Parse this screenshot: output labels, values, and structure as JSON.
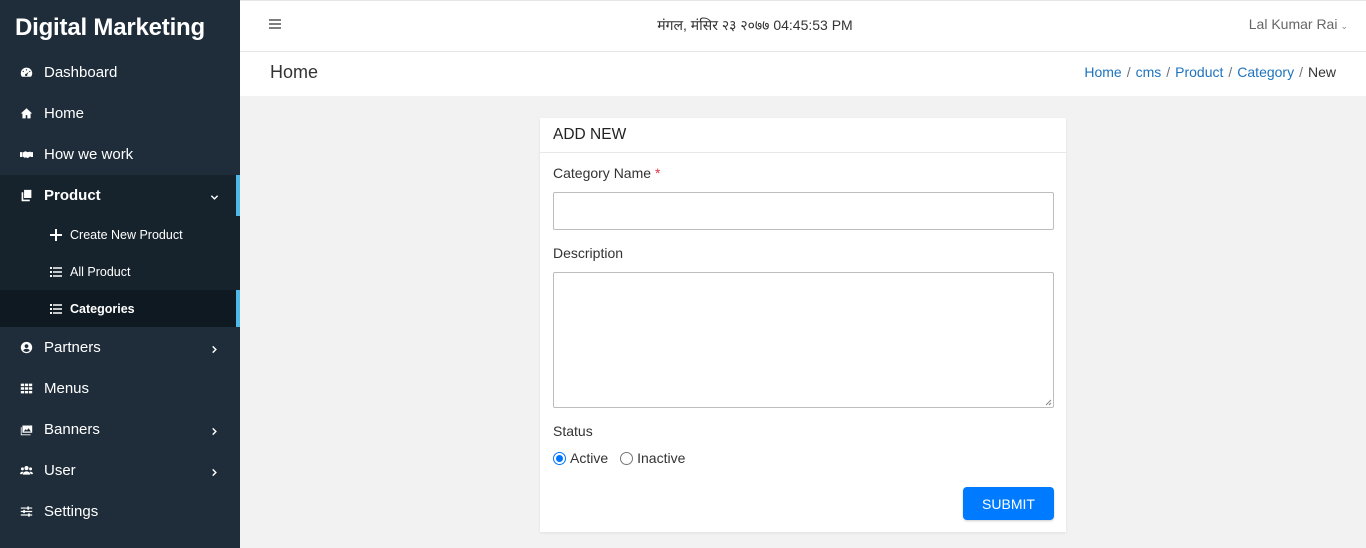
{
  "sidebar": {
    "brand": "Digital Marketing",
    "items": [
      {
        "label": "Dashboard",
        "icon": "dashboard-icon"
      },
      {
        "label": "Home",
        "icon": "home-icon"
      },
      {
        "label": "How we work",
        "icon": "handshake-icon"
      },
      {
        "label": "Product",
        "icon": "copy-icon",
        "expanded": true
      },
      {
        "label": "Partners",
        "icon": "user-circle-icon"
      },
      {
        "label": "Menus",
        "icon": "grid-icon"
      },
      {
        "label": "Banners",
        "icon": "images-icon"
      },
      {
        "label": "User",
        "icon": "users-icon"
      },
      {
        "label": "Settings",
        "icon": "sliders-icon"
      }
    ],
    "product_sub": [
      {
        "label": "Create New Product",
        "icon": "plus-icon"
      },
      {
        "label": "All Product",
        "icon": "list-icon"
      },
      {
        "label": "Categories",
        "icon": "list-icon",
        "current": true
      }
    ],
    "accent_color": "#4fb8e6",
    "bg_color": "#1f2d3a"
  },
  "topbar": {
    "datetime": "मंगल, मंसिर २३ २०७७ 04:45:53 PM",
    "user_name": "Lal Kumar Rai"
  },
  "page": {
    "title": "Home",
    "breadcrumb": [
      "Home",
      "cms",
      "Product",
      "Category",
      "New"
    ]
  },
  "form": {
    "header": "ADD NEW",
    "category_label": "Category Name",
    "required_mark": "*",
    "category_value": "",
    "description_label": "Description",
    "description_value": "",
    "status_label": "Status",
    "status_options": [
      "Active",
      "Inactive"
    ],
    "status_selected": "Active",
    "submit_label": "SUBMIT",
    "submit_color": "#007bff"
  }
}
